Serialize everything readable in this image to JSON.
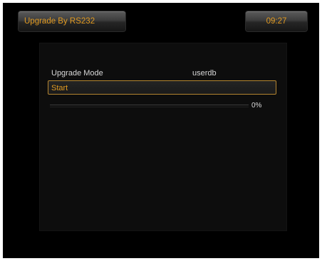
{
  "header": {
    "title": "Upgrade By RS232",
    "time": "09:27"
  },
  "form": {
    "mode_label": "Upgrade Mode",
    "mode_value": "userdb",
    "start_label": "Start"
  },
  "progress": {
    "percent_text": "0%",
    "fraction": 0
  },
  "colors": {
    "accent": "#e09a22",
    "text": "#d8d8d8",
    "background": "#000000"
  }
}
